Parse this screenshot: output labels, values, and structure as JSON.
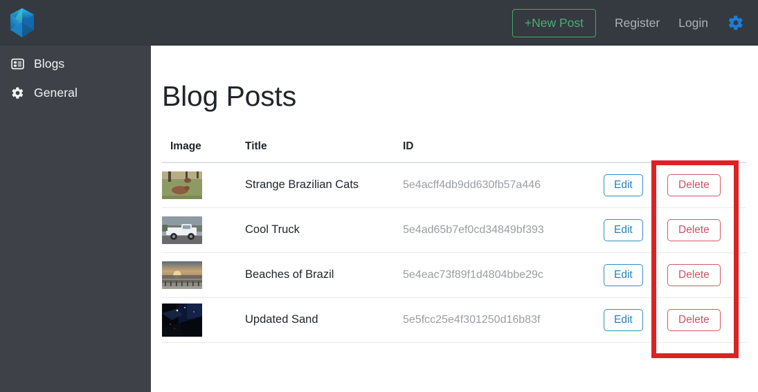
{
  "header": {
    "logo_icon": "gem-logo-icon",
    "new_post_label": "+New Post",
    "register_label": "Register",
    "login_label": "Login",
    "settings_icon": "gear-icon",
    "background_color": "#343a40",
    "new_post_accent": "#4caf72",
    "settings_icon_color": "#1b7ed6"
  },
  "sidebar": {
    "background_color": "#3e4248",
    "items": [
      {
        "label": "Blogs",
        "icon": "list-layout-icon",
        "active": false
      },
      {
        "label": "General",
        "icon": "gear-icon",
        "active": false
      }
    ]
  },
  "main": {
    "page_title": "Blog Posts",
    "table": {
      "columns": [
        "Image",
        "Title",
        "ID",
        "",
        ""
      ],
      "row_actions": {
        "edit_label": "Edit",
        "delete_label": "Delete"
      },
      "rows": [
        {
          "image_alt": "capybara resting in grassy field with trees",
          "title": "Strange Brazilian Cats",
          "id": "5e4acff4db9dd630fb57a446",
          "edit_label": "Edit",
          "delete_label": "Delete"
        },
        {
          "image_alt": "white flatbed pickup truck parked outdoors",
          "title": "Cool Truck",
          "id": "5e4ad65b7ef0cd34849bf393",
          "edit_label": "Edit",
          "delete_label": "Delete"
        },
        {
          "image_alt": "beach pier at sunset",
          "title": "Beaches of Brazil",
          "id": "5e4eac73f89f1d4804bbe29c",
          "edit_label": "Edit",
          "delete_label": "Delete"
        },
        {
          "image_alt": "dark night sky over dune silhouette",
          "title": "Updated Sand",
          "id": "5e5fcc25e4f301250d16b83f",
          "edit_label": "Edit",
          "delete_label": "Delete"
        }
      ]
    }
  },
  "annotation": {
    "shape": "rectangle",
    "color": "#dc2222",
    "target": "delete-button-column"
  }
}
